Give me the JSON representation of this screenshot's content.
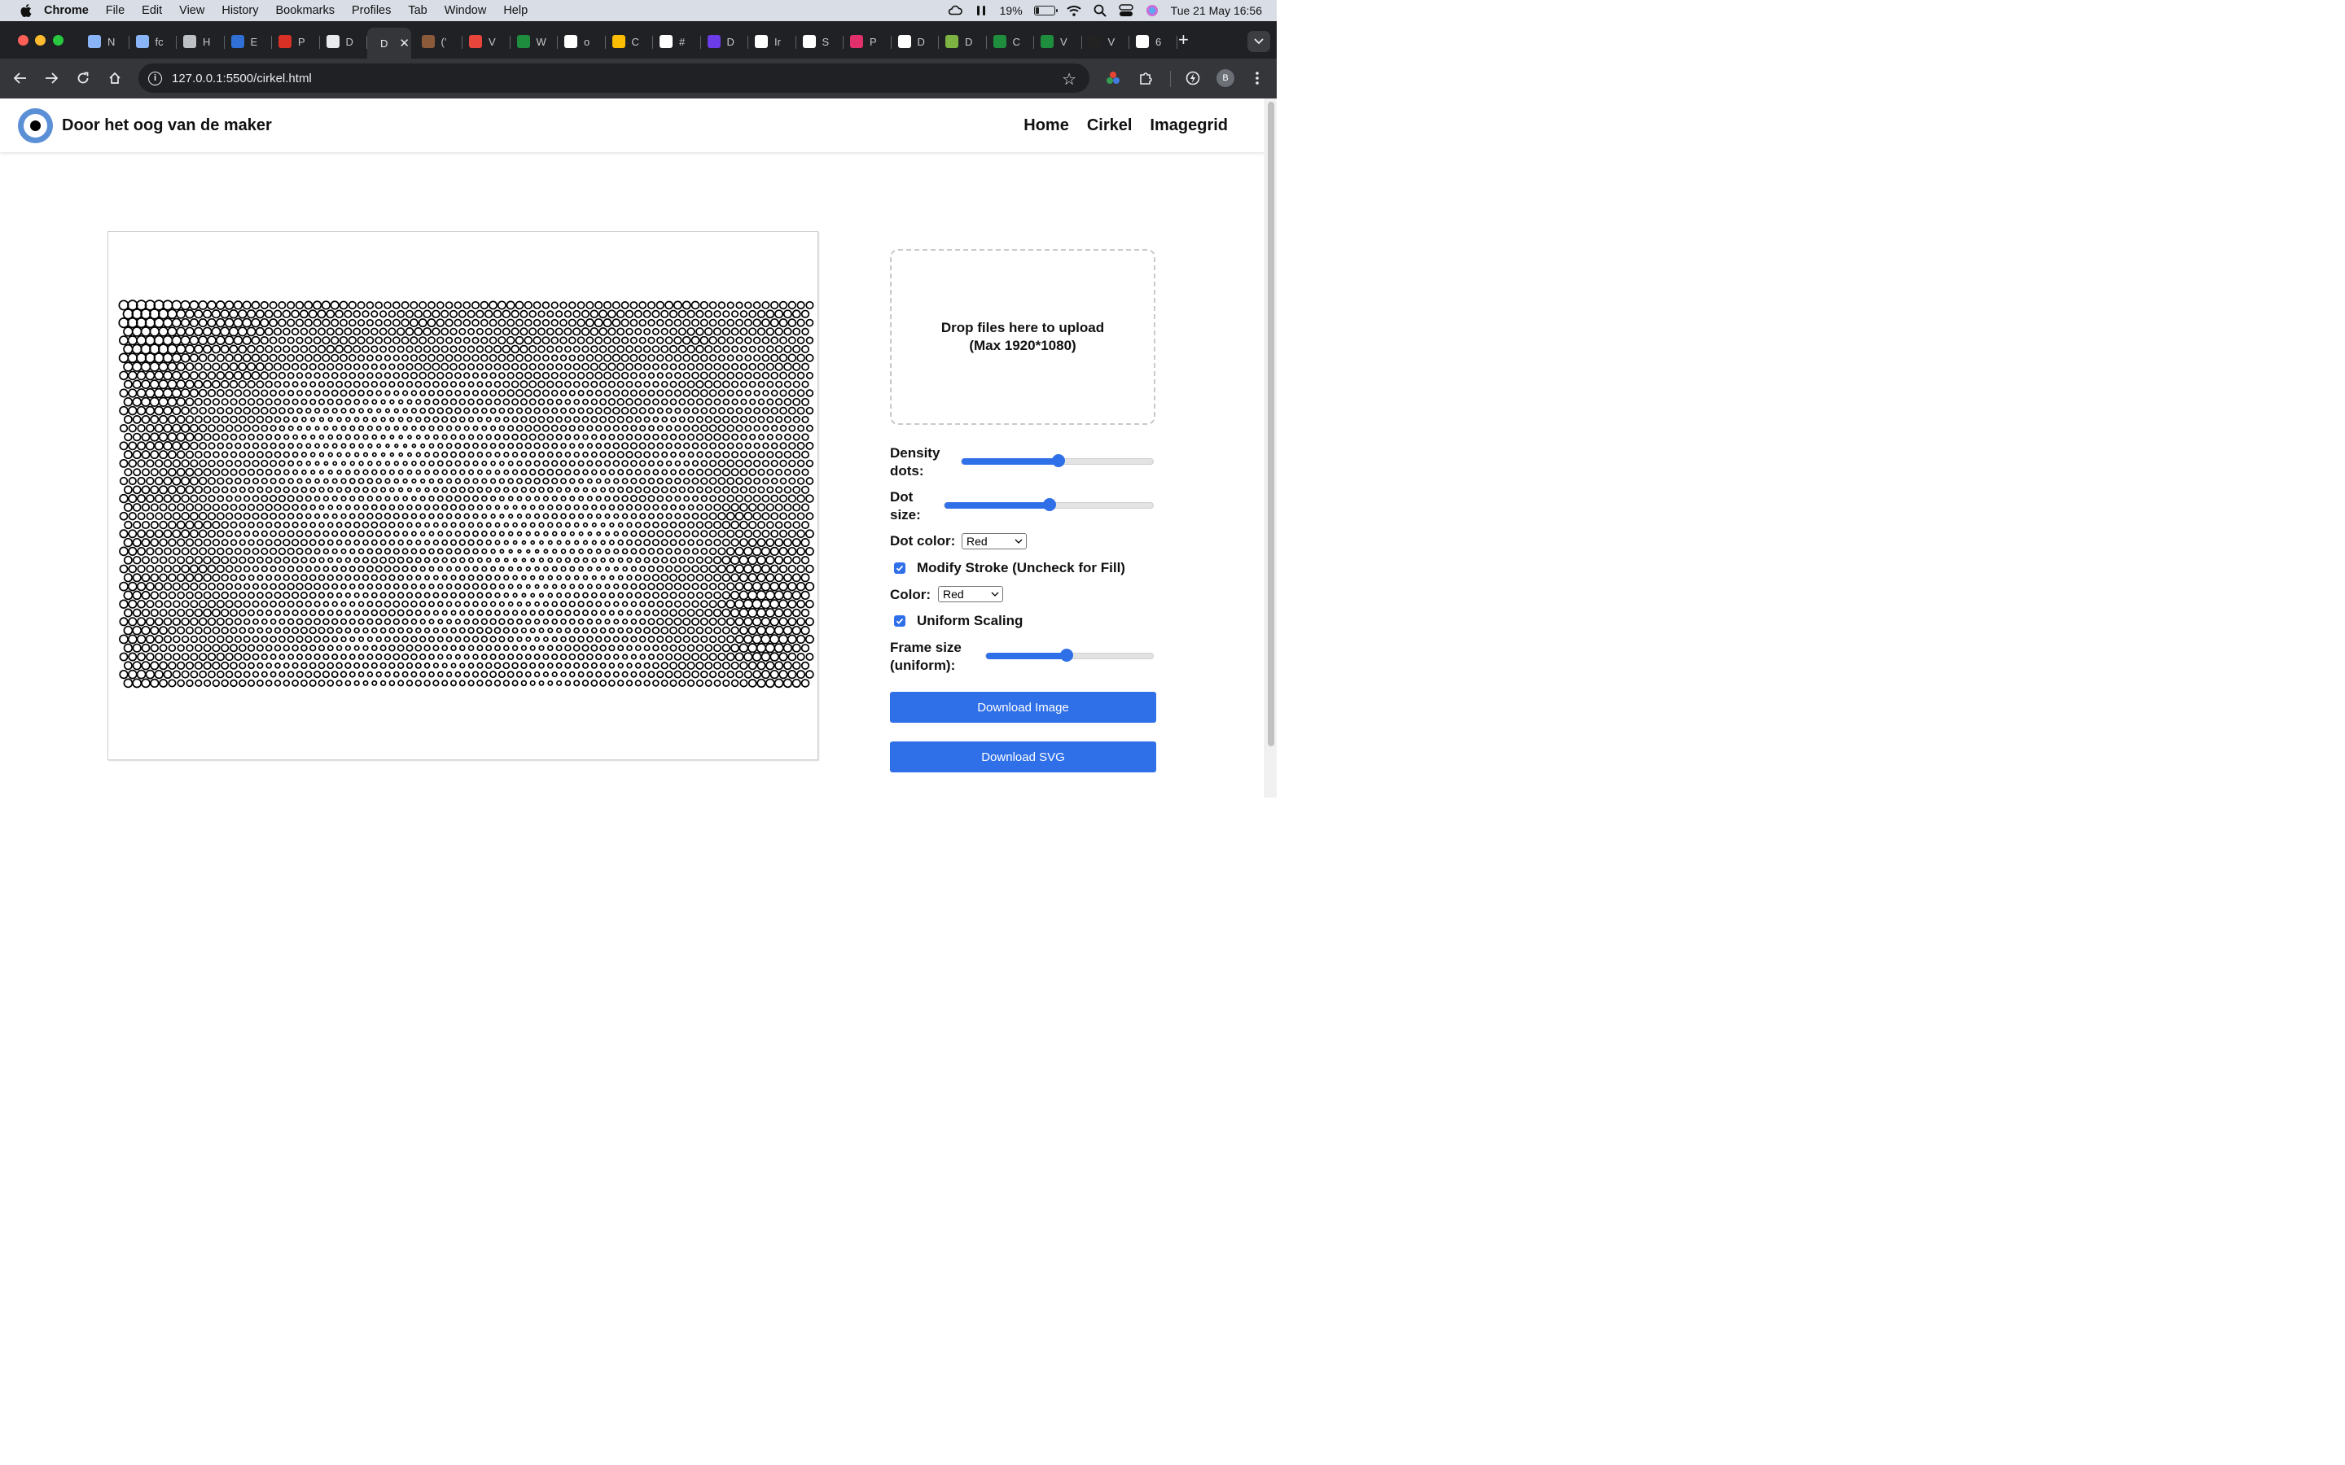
{
  "menubar": {
    "app": "Chrome",
    "items": [
      "File",
      "Edit",
      "View",
      "History",
      "Bookmarks",
      "Profiles",
      "Tab",
      "Window",
      "Help"
    ],
    "battery": "19%",
    "battery_level": 0.19,
    "datetime": "Tue 21 May  16:56"
  },
  "tabs": [
    {
      "label": "N",
      "color": "#8ab4f8"
    },
    {
      "label": "fc",
      "color": "#8ab4f8"
    },
    {
      "label": "H",
      "color": "#bdc1c6"
    },
    {
      "label": "E",
      "color": "#2f6fd6"
    },
    {
      "label": "P",
      "color": "#d93025"
    },
    {
      "label": "D",
      "color": "#e8eaed"
    },
    {
      "label": "D",
      "color": "#35363a",
      "active": true
    },
    {
      "label": "('",
      "color": "#8a5a3a"
    },
    {
      "label": "V",
      "color": "#e8453c"
    },
    {
      "label": "W",
      "color": "#1e8e3e"
    },
    {
      "label": "o",
      "color": "#ffffff"
    },
    {
      "label": "C",
      "color": "#fbbc04"
    },
    {
      "label": "#",
      "color": "#ffffff"
    },
    {
      "label": "D",
      "color": "#6c3ce9"
    },
    {
      "label": "Ir",
      "color": "#ffffff"
    },
    {
      "label": "S",
      "color": "#ffffff"
    },
    {
      "label": "P",
      "color": "#e1306c"
    },
    {
      "label": "D",
      "color": "#ffffff"
    },
    {
      "label": "D",
      "color": "#7cb342"
    },
    {
      "label": "C",
      "color": "#1e8e3e"
    },
    {
      "label": "V",
      "color": "#1e8e3e"
    },
    {
      "label": "V",
      "color": "#222222"
    },
    {
      "label": "6",
      "color": "#ffffff"
    }
  ],
  "toolbar": {
    "url": "127.0.0.1:5500/cirkel.html",
    "profile_initial": "B"
  },
  "site": {
    "title": "Door het oog van de maker",
    "nav": [
      "Home",
      "Cirkel",
      "Imagegrid"
    ]
  },
  "controls": {
    "dropzone_line1": "Drop files here to upload",
    "dropzone_line2": "(Max 1920*1080)",
    "density_label_1": "Density",
    "density_label_2": "dots:",
    "density_value": 0.5,
    "dotsize_label_1": "Dot",
    "dotsize_label_2": "size:",
    "dotsize_value": 0.5,
    "dotcolor_label": "Dot color:",
    "dotcolor_value": "Red",
    "modify_stroke_label": "Modify Stroke (Uncheck for Fill)",
    "modify_stroke_checked": true,
    "color_label": "Color:",
    "color_value": "Red",
    "uniform_label": "Uniform Scaling",
    "uniform_checked": true,
    "frame_label_1": "Frame size",
    "frame_label_2": "(uniform):",
    "frame_value": 0.48,
    "download_image": "Download Image",
    "download_svg": "Download SVG"
  },
  "colors": {
    "accent": "#2f6fe8",
    "logo": "#5b8fd6"
  }
}
